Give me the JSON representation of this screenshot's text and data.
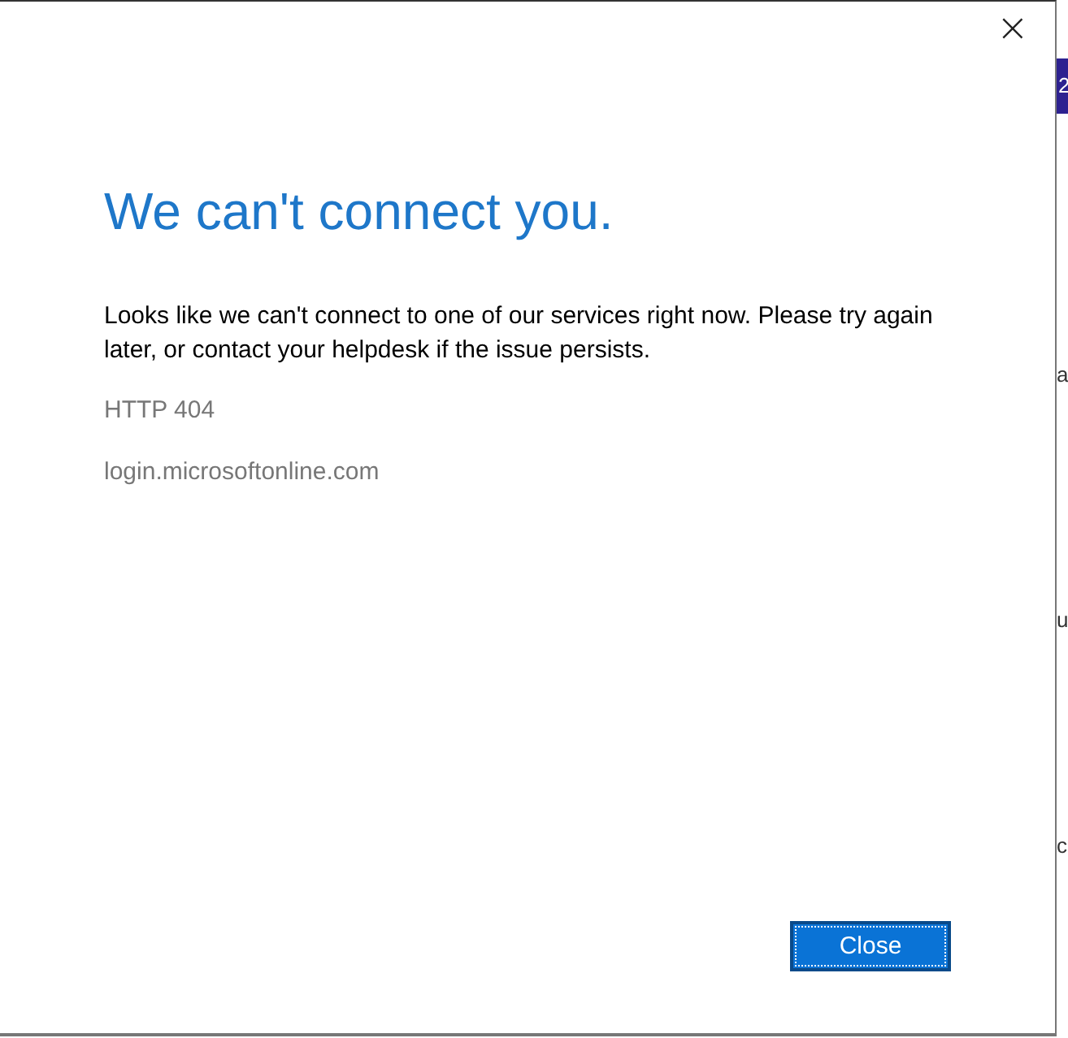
{
  "dialog": {
    "title": "We can't connect you.",
    "message": "Looks like we can't connect to one of our services right now. Please try again later, or contact your helpdesk if the issue persists.",
    "error_code": "HTTP 404",
    "host": "login.microsoftonline.com",
    "close_icon": "×",
    "buttons": [
      {
        "label": "Close",
        "focused": true
      }
    ]
  },
  "background_window": {
    "header_text": "2",
    "fragments": [
      "a",
      "u",
      "c"
    ]
  }
}
